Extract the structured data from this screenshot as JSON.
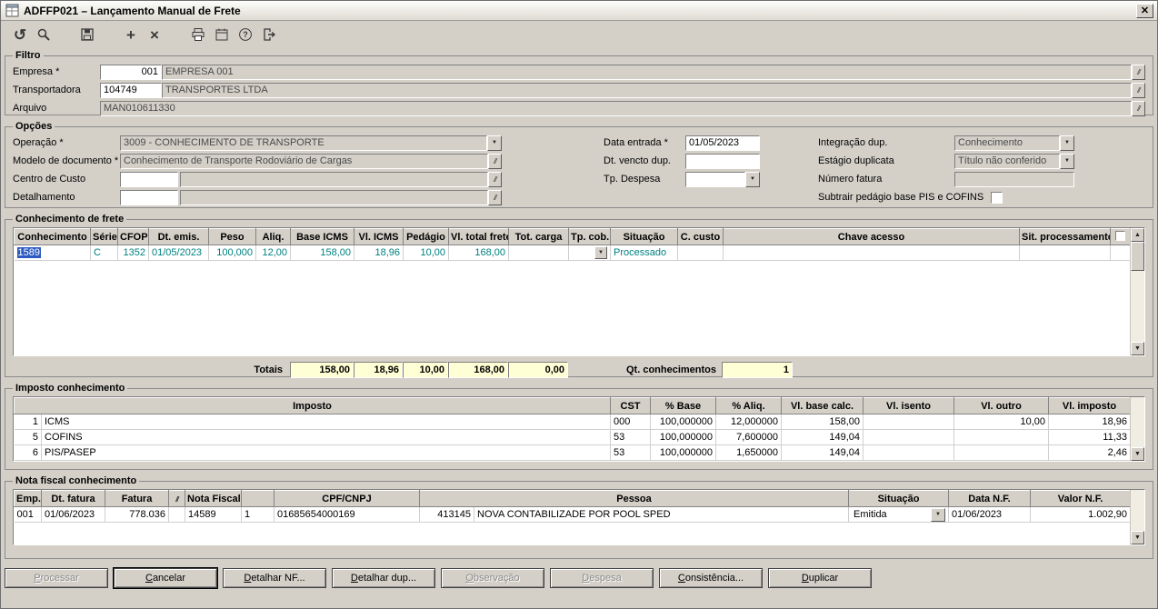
{
  "window": {
    "title": "ADFFP021 – Lançamento Manual de Frete"
  },
  "toolbar": {
    "icons": [
      "refresh-icon",
      "search-icon",
      "save-icon",
      "add-icon",
      "delete-icon",
      "print-icon",
      "calendar-icon",
      "help-icon",
      "exit-icon"
    ]
  },
  "filtro": {
    "legend": "Filtro",
    "empresa_label": "Empresa *",
    "empresa_code": "001",
    "empresa_name": "EMPRESA 001",
    "transportadora_label": "Transportadora",
    "transportadora_code": "104749",
    "transportadora_name": "TRANSPORTES LTDA",
    "arquivo_label": "Arquivo",
    "arquivo_value": "MAN010611330"
  },
  "opcoes": {
    "legend": "Opções",
    "operacao_label": "Operação *",
    "operacao_value": "3009 - CONHECIMENTO DE TRANSPORTE",
    "modelo_label": "Modelo de documento *",
    "modelo_value": "Conhecimento de Transporte Rodoviário de Cargas",
    "centro_custo_label": "Centro de Custo",
    "centro_custo_value": "",
    "detalhamento_label": "Detalhamento",
    "detalhamento_value": "",
    "data_entrada_label": "Data entrada *",
    "data_entrada_value": "01/05/2023",
    "dt_vencto_label": "Dt. vencto dup.",
    "dt_vencto_value": "",
    "tp_despesa_label": "Tp. Despesa",
    "tp_despesa_value": "",
    "integracao_label": "Integração dup.",
    "integracao_value": "Conhecimento",
    "estagio_label": "Estágio duplicata",
    "estagio_value": "Título não conferido",
    "numero_fatura_label": "Número fatura",
    "numero_fatura_value": "",
    "subtrair_label": "Subtrair pedágio base PIS e COFINS",
    "subtrair_checked": false
  },
  "conhecimento": {
    "legend": "Conhecimento de frete",
    "columns": [
      "Conhecimento",
      "Série",
      "CFOP",
      "Dt. emis.",
      "Peso",
      "Aliq.",
      "Base ICMS",
      "Vl. ICMS",
      "Pedágio",
      "Vl. total frete",
      "Tot. carga",
      "Tp. cob.",
      "Situação",
      "C. custo",
      "Chave acesso",
      "Sit. processamento"
    ],
    "rows": [
      [
        "1589",
        "C",
        "1352",
        "01/05/2023",
        "100,000",
        "12,00",
        "158,00",
        "18,96",
        "10,00",
        "168,00",
        "",
        "",
        "Processado",
        "",
        "",
        ""
      ]
    ],
    "totais_label": "Totais",
    "totais": [
      "158,00",
      "18,96",
      "10,00",
      "168,00",
      "0,00"
    ],
    "qt_label": "Qt. conhecimentos",
    "qt_value": "1"
  },
  "imposto": {
    "legend": "Imposto conhecimento",
    "columns": [
      "Imposto",
      "CST",
      "% Base",
      "% Aliq.",
      "Vl. base calc.",
      "Vl. isento",
      "Vl. outro",
      "Vl. imposto"
    ],
    "rows": [
      [
        "1",
        "ICMS",
        "000",
        "100,000000",
        "12,000000",
        "158,00",
        "",
        "10,00",
        "18,96"
      ],
      [
        "5",
        "COFINS",
        "53",
        "100,000000",
        "7,600000",
        "149,04",
        "",
        "",
        "11,33"
      ],
      [
        "6",
        "PIS/PASEP",
        "53",
        "100,000000",
        "1,650000",
        "149,04",
        "",
        "",
        "2,46"
      ]
    ]
  },
  "nota": {
    "legend": "Nota fiscal conhecimento",
    "columns": [
      "Emp.",
      "Dt. fatura",
      "Fatura",
      "Nota Fiscal",
      "CPF/CNPJ",
      "Pessoa",
      "Situação",
      "Data N.F.",
      "Valor N.F."
    ],
    "row": [
      "001",
      "01/06/2023",
      "778.036",
      "",
      "14589",
      "1",
      "01685654000169",
      "413145",
      "NOVA CONTABILIZADE POR POOL SPED",
      "Emitida",
      "01/06/2023",
      "1.002,90"
    ]
  },
  "buttons": [
    {
      "label": "Processar",
      "enabled": false
    },
    {
      "label": "Cancelar",
      "enabled": true
    },
    {
      "label": "Detalhar NF...",
      "enabled": true
    },
    {
      "label": "Detalhar dup...",
      "enabled": true
    },
    {
      "label": "Observação",
      "enabled": false
    },
    {
      "label": "Despesa",
      "enabled": false
    },
    {
      "label": "Consistência...",
      "enabled": true
    },
    {
      "label": "Duplicar",
      "enabled": true
    }
  ],
  "colors": {
    "selection": "#2a5ac2",
    "grid_text": "#008080",
    "totals_bg": "#ffffd6",
    "nf_row_bg": "#cdeef9",
    "chrome": "#d4d0c8"
  }
}
